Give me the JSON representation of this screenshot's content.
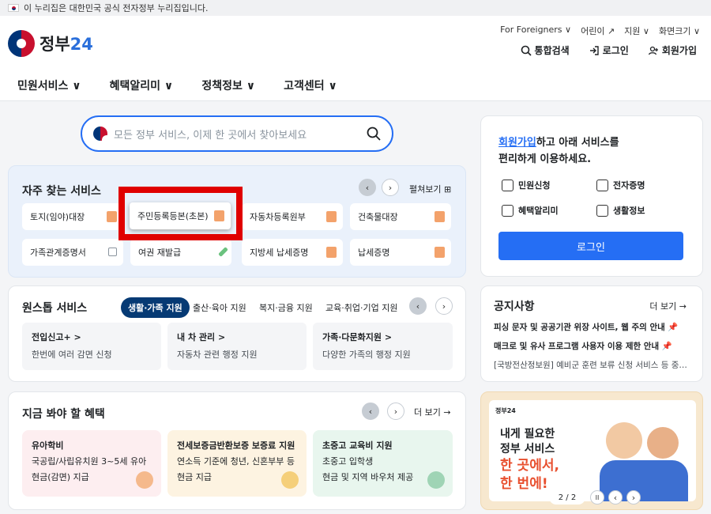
{
  "banner": {
    "text": "이 누리집은 대한민국 공식 전자정부 누리집입니다."
  },
  "header": {
    "logo_text": "정부",
    "logo_num": "24",
    "util": [
      "For Foreigners ∨",
      "어린이 ↗",
      "지원 ∨",
      "화면크기 ∨"
    ],
    "actions": [
      {
        "icon": "search-icon",
        "label": "통합검색"
      },
      {
        "icon": "login-icon",
        "label": "로그인"
      },
      {
        "icon": "user-add-icon",
        "label": "회원가입"
      }
    ]
  },
  "gnb": [
    "민원서비스 ∨",
    "혜택알리미 ∨",
    "정책정보 ∨",
    "고객센터 ∨"
  ],
  "search": {
    "placeholder": "모든 정부 서비스, 이제 한 곳에서 찾아보세요"
  },
  "fav": {
    "title": "자주 찾는 서비스",
    "expand": "펼쳐보기 ⊞",
    "items": [
      "토지(임야)대장",
      "주민등록등본(초본)",
      "자동차등록원부",
      "건축물대장",
      "가족관계증명서",
      "여권 재발급",
      "지방세 납세증명",
      "납세증명"
    ]
  },
  "onestop": {
    "title": "원스톱 서비스",
    "tabs": [
      "생활·가족 지원",
      "출산·육아 지원",
      "복지·금융 지원",
      "교육·취업·기업 지원"
    ],
    "cards": [
      {
        "title": "전입신고+ >",
        "desc": "한번에 여러 감면 신청"
      },
      {
        "title": "내 차 관리 >",
        "desc": "자동차 관련 행정 지원"
      },
      {
        "title": "가족·다문화지원 >",
        "desc": "다양한 가족의 행정 지원"
      }
    ]
  },
  "benefit": {
    "title": "지금 봐야 할 혜택",
    "more": "더 보기 →",
    "cards": [
      {
        "title": "유아학비",
        "l1": "국공립/사립유치원 3~5세 유아",
        "l2": "현금(감면) 지급",
        "color": "#fdeef0"
      },
      {
        "title": "전세보증금반환보증 보증료 지원",
        "l1": "연소득 기준에 청년, 신혼부부 등",
        "l2": "현금 지급",
        "color": "#fdf3e1"
      },
      {
        "title": "초중고 교육비 지원",
        "l1": "초중고 입학생",
        "l2": "현금 및 지역 바우처 제공",
        "color": "#e8f6ee"
      }
    ]
  },
  "login": {
    "title_link": "회원가입",
    "title_rest": "하고 아래 서비스를",
    "title_l2": "편리하게 이용하세요.",
    "services": [
      {
        "icon": "mail-icon",
        "label": "민원신청"
      },
      {
        "icon": "certificate-icon",
        "label": "전자증명"
      },
      {
        "icon": "gift-icon",
        "label": "혜택알리미"
      },
      {
        "icon": "bookmark-icon",
        "label": "생활정보"
      }
    ],
    "button": "로그인"
  },
  "notice": {
    "title": "공지사항",
    "more": "더 보기 →",
    "items": [
      "피싱 문자 및 공공기관 위장 사이트, 웹 주의 안내 📌",
      "매크로 및 유사 프로그램 사용자 이용 제한 안내 📌",
      "[국방전산정보원] 예비군 훈련 보류 신청 서비스 등 중…"
    ]
  },
  "promo": {
    "logo": "정부24",
    "l1": "내게 필요한",
    "l2": "정부 서비스",
    "l3": "한 곳에서,",
    "l4": "한 번에!",
    "pager": "2 / 2"
  }
}
